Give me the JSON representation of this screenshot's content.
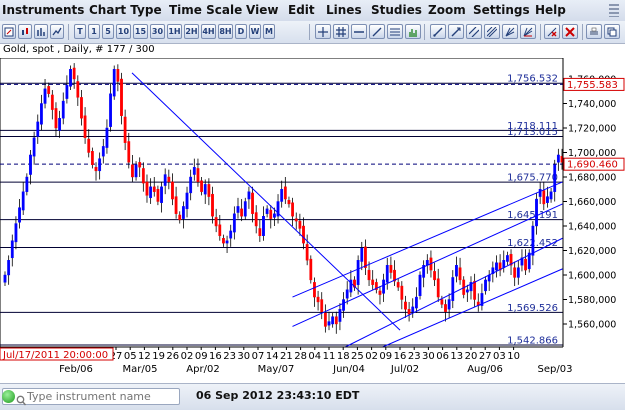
{
  "menu": [
    "Instruments",
    "Chart Type",
    "Time Scale",
    "View",
    "Edit",
    "Lines",
    "Studies",
    "Zoom",
    "Settings",
    "Help"
  ],
  "toolbar": {
    "timeframes": [
      "T",
      "1",
      "5",
      "10",
      "15",
      "30",
      "1H",
      "2H",
      "4H",
      "8H",
      "D",
      "W",
      "M"
    ]
  },
  "chart_info": "Gold, spot , Daily, # 177 / 300",
  "price_axis": {
    "ticks": [
      {
        "v": 1760,
        "t": "1,760,000"
      },
      {
        "v": 1740,
        "t": "1,740,000"
      },
      {
        "v": 1720,
        "t": "1,720,000"
      },
      {
        "v": 1700,
        "t": "1,700,000"
      },
      {
        "v": 1680,
        "t": "1,680,000"
      },
      {
        "v": 1660,
        "t": "1,660,000"
      },
      {
        "v": 1640,
        "t": "1,640,000"
      },
      {
        "v": 1620,
        "t": "1,620,000"
      },
      {
        "v": 1600,
        "t": "1,600,000"
      },
      {
        "v": 1580,
        "t": "1,580,000"
      },
      {
        "v": 1560,
        "t": "1,560,000"
      }
    ],
    "current_price": "1,690.460",
    "current_value": 1690.46,
    "top_label": "1,755.583",
    "top_value": 1755.583
  },
  "levels": [
    {
      "v": 1756.532,
      "t": "1,756.532"
    },
    {
      "v": 1718.111,
      "t": "1,718.111"
    },
    {
      "v": 1713.015,
      "t": "1,713.015"
    },
    {
      "v": 1675.77,
      "t": "1,675.770"
    },
    {
      "v": 1645.191,
      "t": "1,645.191"
    },
    {
      "v": 1622.452,
      "t": "1,622.452"
    },
    {
      "v": 1569.526,
      "t": "1,569.526"
    },
    {
      "v": 1542.866,
      "t": "1,542.866"
    }
  ],
  "date_axis": {
    "cursor_date": "Jul/17/2011 20:00:00",
    "days": [
      "27",
      "05",
      "12",
      "19",
      "26",
      "02",
      "09",
      "16",
      "23",
      "30",
      "07",
      "14",
      "21",
      "28",
      "04",
      "11",
      "18",
      "25",
      "02",
      "09",
      "16",
      "23",
      "30",
      "06",
      "13",
      "20",
      "27",
      "03",
      "10"
    ],
    "months": [
      "Feb/06",
      "Mar/05",
      "Apr/02",
      "May/07",
      "Jun/04",
      "Jul/02",
      "Aug/06",
      "Sep/03"
    ]
  },
  "statusbar": {
    "search_placeholder": "Type instrument name",
    "datetime": "06 Sep 2012 23:43:10 EDT"
  },
  "colors": {
    "bull": "#0000ff",
    "bear": "#ff0000",
    "line": "#0000ff",
    "price_label": "#d40000"
  },
  "chart_data": {
    "type": "candlestick",
    "title": "Gold, spot , Daily",
    "ylim": [
      1535,
      1775
    ],
    "closes": [
      1600,
      1612,
      1628,
      1642,
      1655,
      1668,
      1680,
      1698,
      1712,
      1725,
      1740,
      1752,
      1748,
      1735,
      1720,
      1728,
      1742,
      1755,
      1768,
      1760,
      1745,
      1728,
      1712,
      1700,
      1690,
      1685,
      1695,
      1705,
      1720,
      1748,
      1768,
      1758,
      1730,
      1708,
      1692,
      1680,
      1690,
      1688,
      1675,
      1665,
      1672,
      1668,
      1660,
      1672,
      1682,
      1676,
      1662,
      1650,
      1645,
      1656,
      1667,
      1680,
      1688,
      1676,
      1668,
      1674,
      1664,
      1648,
      1640,
      1632,
      1626,
      1628,
      1636,
      1650,
      1656,
      1648,
      1660,
      1668,
      1650,
      1640,
      1632,
      1648,
      1654,
      1646,
      1650,
      1660,
      1670,
      1662,
      1658,
      1648,
      1644,
      1638,
      1626,
      1612,
      1596,
      1582,
      1578,
      1570,
      1558,
      1562,
      1566,
      1560,
      1572,
      1580,
      1588,
      1596,
      1590,
      1612,
      1622,
      1606,
      1596,
      1592,
      1588,
      1584,
      1596,
      1608,
      1602,
      1595,
      1590,
      1580,
      1572,
      1568,
      1574,
      1582,
      1600,
      1608,
      1612,
      1604,
      1596,
      1582,
      1576,
      1570,
      1580,
      1598,
      1608,
      1596,
      1584,
      1588,
      1594,
      1580,
      1575,
      1585,
      1596,
      1600,
      1606,
      1610,
      1604,
      1612,
      1616,
      1608,
      1598,
      1606,
      1614,
      1604,
      1618,
      1640,
      1662,
      1670,
      1658,
      1664,
      1668,
      1690,
      1698,
      1692
    ],
    "trendlines": [
      {
        "from": [
          "Mar/01",
          1765
        ],
        "to": [
          "Jun/29",
          1555
        ]
      },
      {
        "from": [
          "May/14",
          1582
        ],
        "to": [
          "Sep/10",
          1676
        ]
      },
      {
        "from": [
          "May/14",
          1558
        ],
        "to": [
          "Sep/10",
          1658
        ]
      },
      {
        "from": [
          "Jun/01",
          1535
        ],
        "to": [
          "Sep/10",
          1630
        ]
      },
      {
        "from": [
          "Jun/15",
          1535
        ],
        "to": [
          "Sep/10",
          1605
        ]
      }
    ]
  }
}
